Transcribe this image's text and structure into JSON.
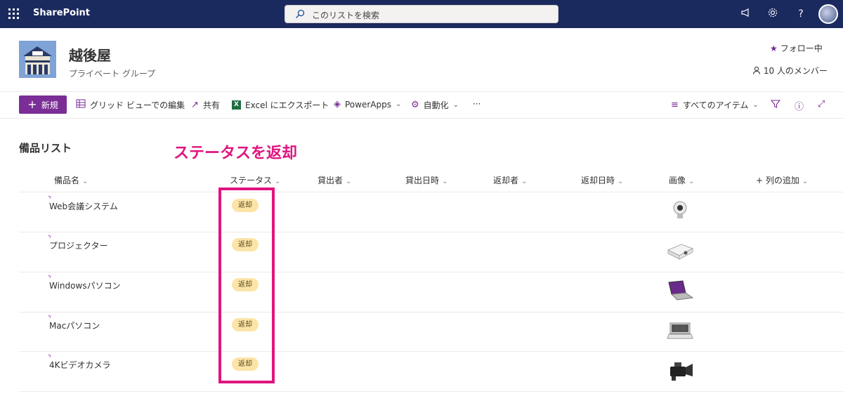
{
  "suitebar": {
    "brand": "SharePoint",
    "search_placeholder": "このリストを検索",
    "help_label": "?"
  },
  "site": {
    "title": "越後屋",
    "subtitle": "プライベート グループ",
    "follow_label": "フォロー中",
    "members_label": "10 人のメンバー"
  },
  "commandbar": {
    "new_label": "新規",
    "grid_edit_label": "グリッド ビューでの編集",
    "share_label": "共有",
    "excel_label": "Excel にエクスポート",
    "powerapps_label": "PowerApps",
    "automate_label": "自動化",
    "more_label": "···",
    "view_label": "すべてのアイテム"
  },
  "list": {
    "title": "備品リスト",
    "annotation": "ステータスを返却",
    "columns": [
      "備品名",
      "ステータス",
      "貸出者",
      "貸出日時",
      "返却者",
      "返却日時",
      "画像",
      "列の追加"
    ],
    "add_column_prefix": "+",
    "rows": [
      {
        "name": "Web会議システム",
        "status": "返却",
        "image": "webcam"
      },
      {
        "name": "プロジェクター",
        "status": "返却",
        "image": "projector"
      },
      {
        "name": "Windowsパソコン",
        "status": "返却",
        "image": "windows-laptop"
      },
      {
        "name": "Macパソコン",
        "status": "返却",
        "image": "mac-laptop"
      },
      {
        "name": "4Kビデオカメラ",
        "status": "返却",
        "image": "video-camera"
      }
    ]
  },
  "colors": {
    "suitebar": "#1b2a5e",
    "accent": "#7a2e96",
    "annotation": "#e0157f",
    "status_pill": "#fbe4a6"
  }
}
